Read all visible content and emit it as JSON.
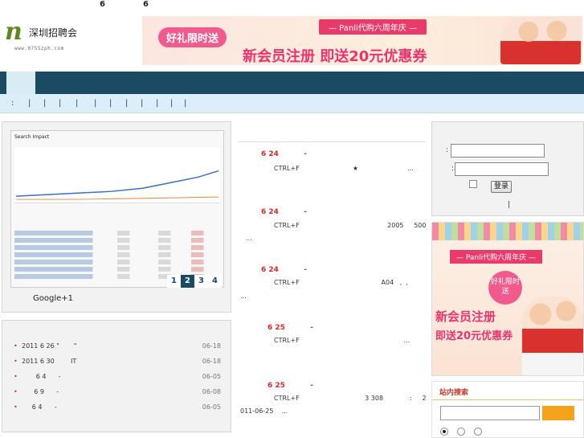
{
  "header": {
    "top_numbers": [
      "6",
      "6"
    ],
    "logo": {
      "mark": "n",
      "name": "深圳招聘会",
      "url": "www.0755zph.com"
    },
    "banner": {
      "badge": "好礼限时送",
      "ribbon": "— Panli代购六周年庆 —",
      "promo": "新会员注册 即送20元优惠券"
    }
  },
  "subnav": {
    "items": [
      ":",
      "|",
      "|",
      "|",
      "|",
      "|",
      "|",
      "|",
      "|",
      "|",
      "|",
      "|"
    ]
  },
  "slider": {
    "image_heading": "Search Impact",
    "pages": [
      "1",
      "2",
      "3",
      "4"
    ],
    "current_page": 2,
    "caption": "Google+1"
  },
  "left_list": [
    {
      "text": "2011 6 26 \"       \"",
      "date": "06-18"
    },
    {
      "text": "2011 6 30        IT",
      "date": "06-18"
    },
    {
      "text": "       6 4      -",
      "date": "06-05"
    },
    {
      "text": "      6 9      -",
      "date": "06-08"
    },
    {
      "text": "     6 4      -",
      "date": "06-05"
    }
  ],
  "news": [
    {
      "head": "6 24          -",
      "line1": "CTRL+F                          ★                        ...",
      "line2": ""
    },
    {
      "head": "6 24          -",
      "line1": "CTRL+F                                           2005     500",
      "line2": "..."
    },
    {
      "head": "6 24          -",
      "line1": "CTRL+F                                        A04   ,  ,",
      "line2": "..."
    },
    {
      "head": "6 25          -",
      "line1": "CTRL+F                                                   ...",
      "line2": ""
    },
    {
      "head": "6 25          -",
      "line1": "CTRL+F                                3 308             :     2",
      "line2": "011-06-25    ..."
    }
  ],
  "login": {
    "user_label": ":",
    "pass_label": ":",
    "submit": "登录",
    "separator": "|"
  },
  "side_banner": {
    "ribbon": "— Panli代购六周年庆 —",
    "bubble": "好礼限时送",
    "line1": "新会员注册",
    "line2": "即送20元优惠券"
  },
  "search": {
    "title": "站内搜索",
    "placeholder": ""
  },
  "colors": {
    "nav": "#1b4a63",
    "subnav": "#dceef7",
    "accent_red": "#d42b2b",
    "search_button": "#f7a21b",
    "promo_pink": "#e8336d"
  }
}
